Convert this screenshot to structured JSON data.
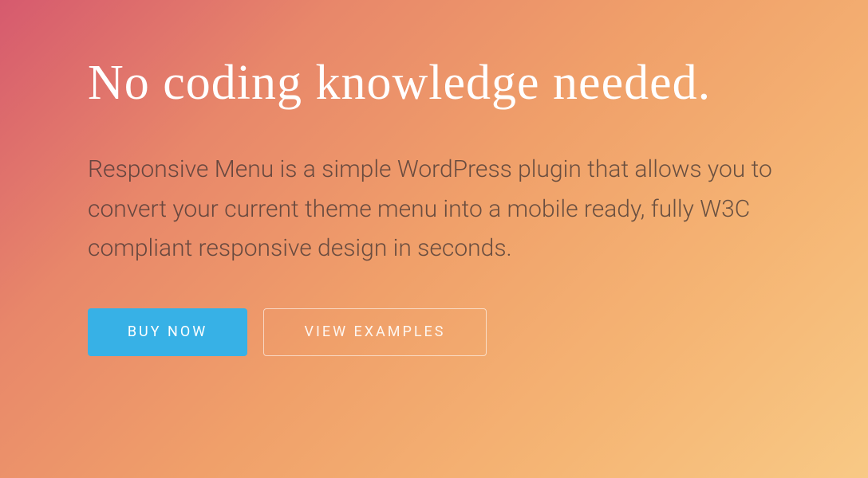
{
  "hero": {
    "headline": "No coding knowledge needed.",
    "description": "Responsive Menu is a simple WordPress plugin that allows you to convert your current theme menu into a mobile ready, fully W3C compliant responsive design in seconds.",
    "buttons": {
      "primary": "BUY NOW",
      "secondary": "VIEW EXAMPLES"
    }
  },
  "colors": {
    "primary_button": "#37b1e6",
    "headline": "#ffffff"
  }
}
